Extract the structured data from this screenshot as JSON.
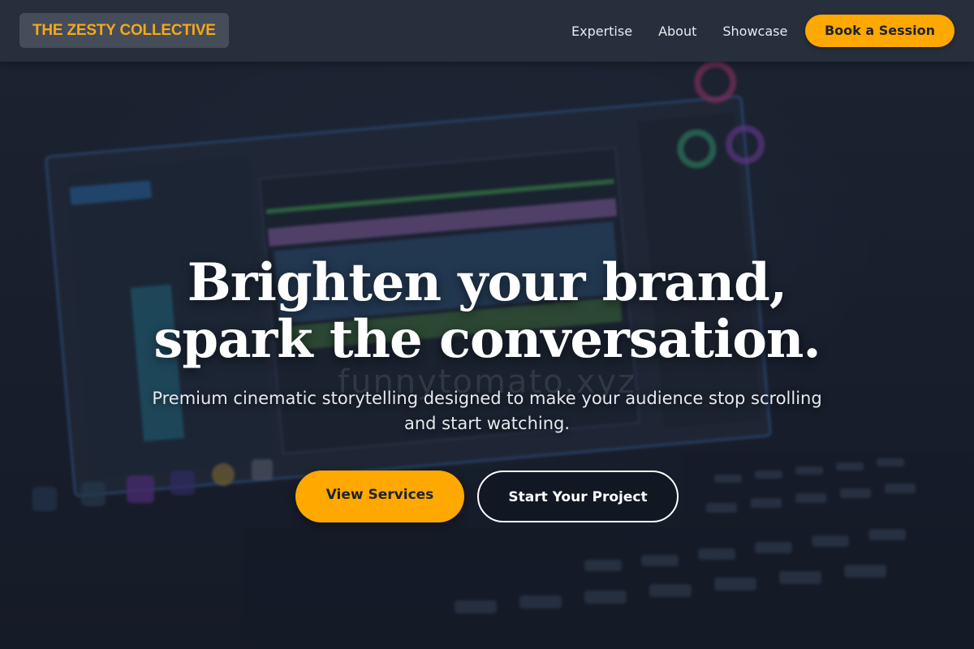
{
  "navbar": {
    "logo_text": "THE ZESTY COLLECTIVE",
    "links": [
      "Expertise",
      "About",
      "Showcase"
    ],
    "cta_label": "Book a Session"
  },
  "hero": {
    "headline_line1": "Brighten your brand,",
    "headline_line2": "spark the conversation.",
    "subheadline": "Premium cinematic storytelling designed to make your audience stop scrolling and start watching.",
    "primary_button": "View Services",
    "secondary_button": "Start Your Project"
  },
  "background": {
    "watermark_text": "funnytomato.xyz"
  },
  "colors": {
    "accent": "#ffa800",
    "navbar": "#282f3e",
    "text_light": "#ffffff"
  }
}
